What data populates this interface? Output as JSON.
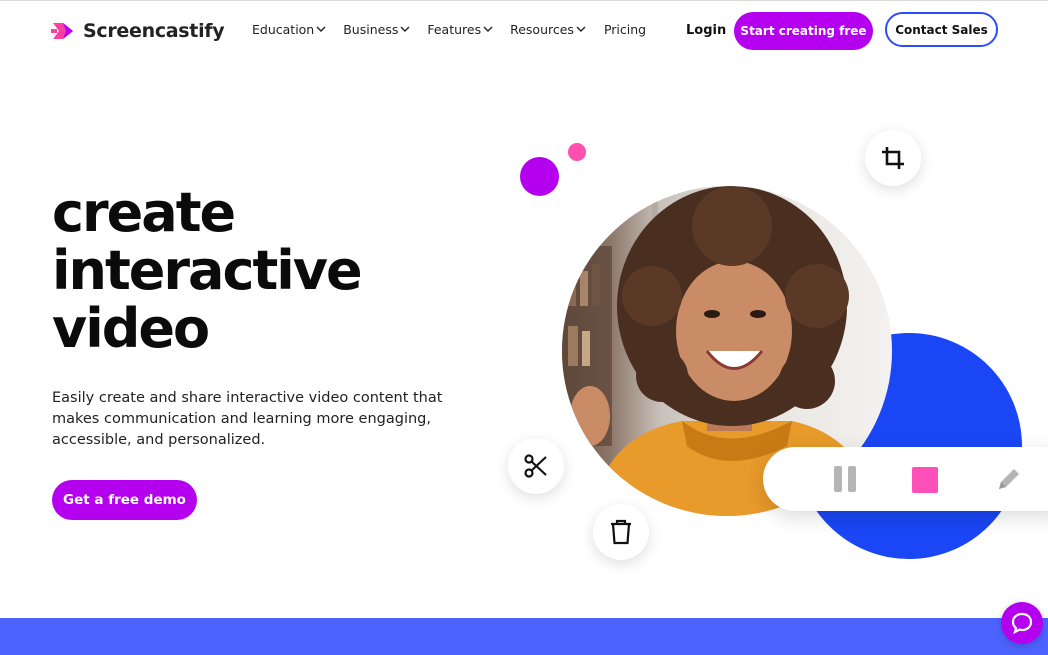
{
  "brand": {
    "name": "Screencastify",
    "logo_icon": "screencastify-logo-icon"
  },
  "nav": {
    "items": [
      {
        "label": "Education",
        "has_dropdown": true
      },
      {
        "label": "Business",
        "has_dropdown": true
      },
      {
        "label": "Features",
        "has_dropdown": true
      },
      {
        "label": "Resources",
        "has_dropdown": true
      },
      {
        "label": "Pricing",
        "has_dropdown": false
      }
    ],
    "login_label": "Login",
    "start_label": "Start creating free",
    "contact_label": "Contact Sales"
  },
  "hero": {
    "headline_lines": [
      "create",
      "interactive",
      "video"
    ],
    "subtext": "Easily create and share interactive video content that makes communication and learning more engaging, accessible, and personalized.",
    "cta_label": "Get a free demo"
  },
  "media_controls": {
    "icons": [
      "crop-icon",
      "scissors-icon",
      "trash-icon",
      "pause-icon",
      "stop-icon",
      "pencil-icon"
    ]
  },
  "chat": {
    "icon": "chat-icon"
  },
  "colors": {
    "primary_purple": "#b400ee",
    "accent_pink": "#ff4fb0",
    "accent_blue": "#1a46f5",
    "band_blue": "#4d63ff",
    "contact_border": "#2b4dff"
  }
}
